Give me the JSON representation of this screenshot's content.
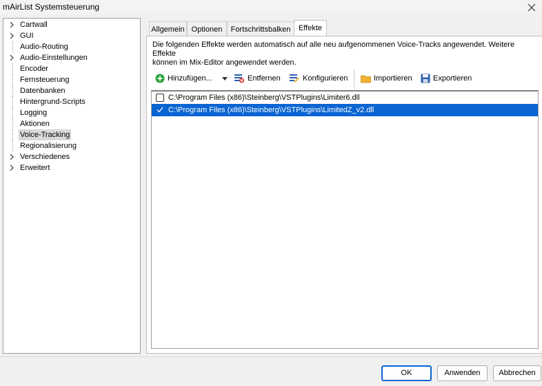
{
  "window": {
    "title": "mAirList Systemsteuerung"
  },
  "tree": {
    "items": [
      {
        "label": "Cartwall",
        "expandable": true
      },
      {
        "label": "GUI",
        "expandable": true
      },
      {
        "label": "Audio-Routing",
        "expandable": false
      },
      {
        "label": "Audio-Einstellungen",
        "expandable": true
      },
      {
        "label": "Encoder",
        "expandable": false
      },
      {
        "label": "Fernsteuerung",
        "expandable": false
      },
      {
        "label": "Datenbanken",
        "expandable": false
      },
      {
        "label": "Hintergrund-Scripts",
        "expandable": false
      },
      {
        "label": "Logging",
        "expandable": false
      },
      {
        "label": "Aktionen",
        "expandable": false
      },
      {
        "label": "Voice-Tracking",
        "expandable": false,
        "selected": true
      },
      {
        "label": "Regionalisierung",
        "expandable": false
      },
      {
        "label": "Verschiedenes",
        "expandable": true
      },
      {
        "label": "Erweitert",
        "expandable": true
      }
    ]
  },
  "tabs": [
    {
      "label": "Allgemein"
    },
    {
      "label": "Optionen"
    },
    {
      "label": "Fortschrittsbalken"
    },
    {
      "label": "Effekte",
      "active": true
    }
  ],
  "effects": {
    "description_line1": "Die folgenden Effekte werden automatisch auf alle neu aufgenommenen Voice-Tracks angewendet. Weitere Effekte",
    "description_line2": "können im Mix-Editor angewendet werden.",
    "toolbar": {
      "add_label": "Hinzufügen...",
      "remove_label": "Entfernen",
      "configure_label": "Konfigurieren",
      "import_label": "Importieren",
      "export_label": "Exportieren"
    },
    "items": [
      {
        "path": "C:\\Program Files (x86)\\Steinberg\\VSTPlugins\\Limiter6.dll",
        "checked": false,
        "selected": false
      },
      {
        "path": "C:\\Program Files (x86)\\Steinberg\\VSTPlugins\\LimitedZ_v2.dll",
        "checked": true,
        "selected": true
      }
    ]
  },
  "buttons": {
    "ok": "OK",
    "apply": "Anwenden",
    "cancel": "Abbrechen"
  },
  "colors": {
    "selection": "#0a64d2",
    "add_icon": "#2ea043",
    "folder_icon": "#f2b233",
    "save_icon": "#2a5db0"
  }
}
